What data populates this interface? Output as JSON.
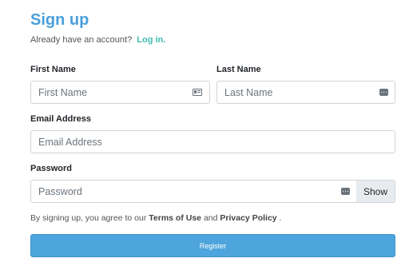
{
  "header": {
    "title": "Sign up",
    "subtitle": "Already have an account?",
    "login_link": "Log in."
  },
  "form": {
    "first_name": {
      "label": "First Name",
      "placeholder": "First Name",
      "value": "",
      "icon": "contact-card-icon"
    },
    "last_name": {
      "label": "Last Name",
      "placeholder": "Last Name",
      "value": "",
      "icon": "keyboard-icon"
    },
    "email": {
      "label": "Email Address",
      "placeholder": "Email Address",
      "value": ""
    },
    "password": {
      "label": "Password",
      "placeholder": "Password",
      "value": "",
      "icon": "keyboard-icon",
      "show_label": "Show"
    }
  },
  "terms": {
    "prefix": "By signing up, you agree to our",
    "terms_link": "Terms of Use",
    "and": "and",
    "privacy_link": "Privacy Policy",
    "suffix": "."
  },
  "register_label": "Register",
  "colors": {
    "title": "#4a9fdb",
    "link": "#3ebfb2",
    "button": "#4ea4dc"
  }
}
